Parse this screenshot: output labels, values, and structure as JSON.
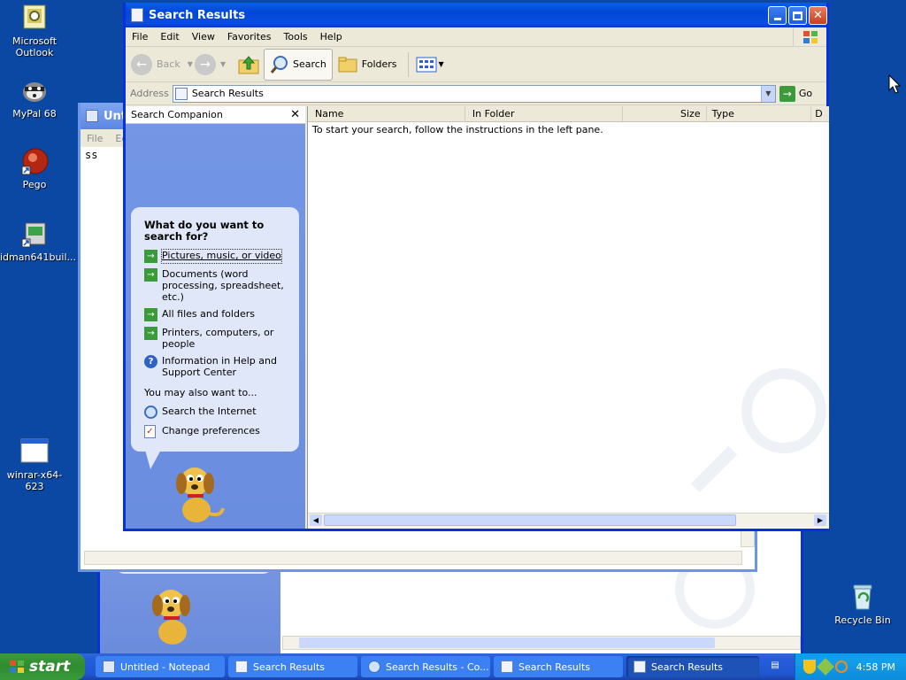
{
  "desktop": {
    "icons": [
      {
        "label": "Microsoft Outlook"
      },
      {
        "label": "MyPal 68"
      },
      {
        "label": "Pego"
      },
      {
        "label": "idman641buil..."
      },
      {
        "label": "winrar-x64-623"
      },
      {
        "label": "Recycle Bin"
      }
    ]
  },
  "notepad_bg": {
    "title": "Unti",
    "menu": [
      "File",
      "Ed"
    ],
    "content": "ss"
  },
  "window": {
    "title": "Search Results",
    "menu": [
      "File",
      "Edit",
      "View",
      "Favorites",
      "Tools",
      "Help"
    ],
    "toolbar": {
      "back": "Back",
      "search": "Search",
      "folders": "Folders"
    },
    "address": {
      "label": "Address",
      "value": "Search Results",
      "go": "Go"
    },
    "companion": {
      "title": "Search Companion",
      "question": "What do you want to search for?",
      "options": [
        "Pictures, music, or video",
        "Documents (word processing, spreadsheet, etc.)",
        "All files and folders",
        "Printers, computers, or people",
        "Information in Help and Support Center"
      ],
      "also_label": "You may also want to...",
      "also": [
        "Search the Internet",
        "Change preferences"
      ]
    },
    "columns": [
      "Name",
      "In Folder",
      "Size",
      "Type",
      "D"
    ],
    "empty_message": "To start your search, follow the instructions in the left pane."
  },
  "taskbar": {
    "start": "start",
    "tasks": [
      "Untitled - Notepad",
      "Search Results",
      "Search Results - Co...",
      "Search Results",
      "Search Results"
    ],
    "clock": "4:58 PM"
  }
}
